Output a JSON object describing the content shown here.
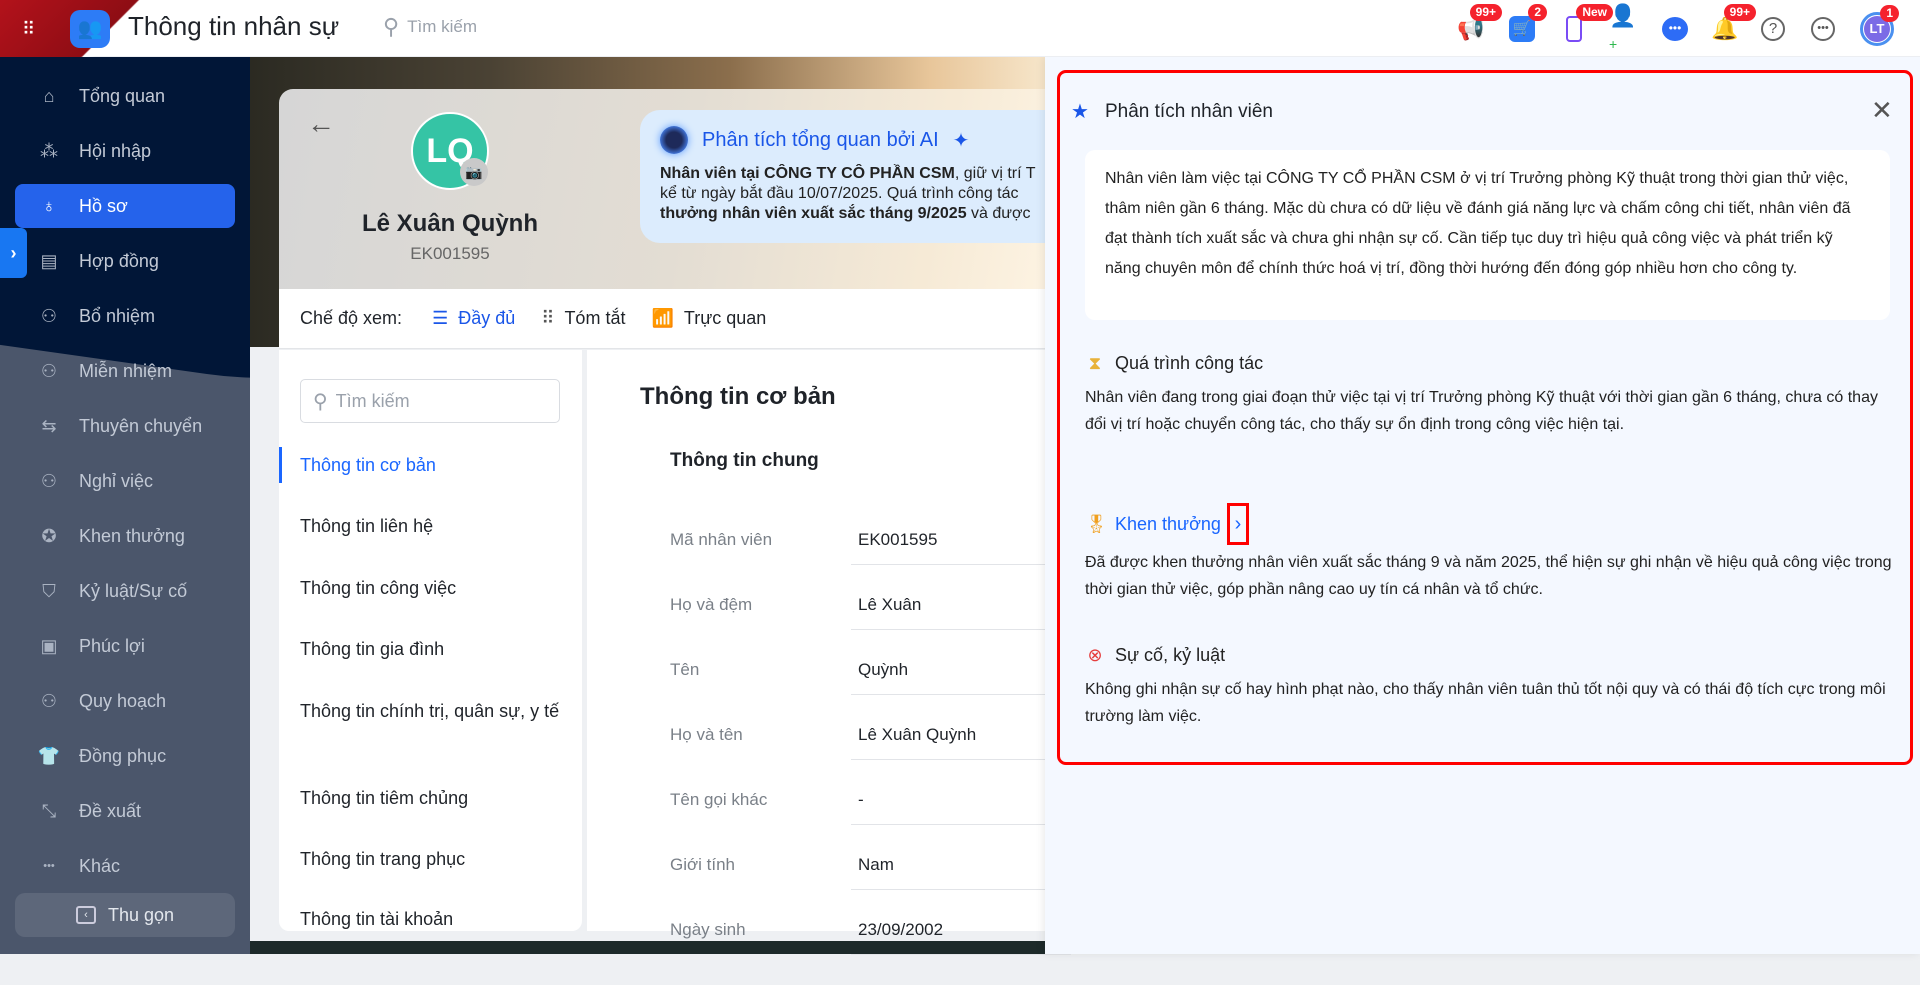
{
  "header": {
    "app_title": "Thông tin nhân sự",
    "search_placeholder": "Tìm kiếm",
    "badges": {
      "announcements": "99+",
      "cart": "2",
      "mobile": "New",
      "notifications": "99+",
      "avatar": "1"
    },
    "avatar_initials": "LT"
  },
  "sidebar": {
    "items": [
      {
        "label": "Tổng quan",
        "icon": "home-icon"
      },
      {
        "label": "Hội nhập",
        "icon": "team-icon"
      },
      {
        "label": "Hồ sơ",
        "icon": "user-icon",
        "active": true
      },
      {
        "label": "Hợp đồng",
        "icon": "document-icon"
      },
      {
        "label": "Bổ nhiệm",
        "icon": "user-plus-icon"
      },
      {
        "label": "Miễn nhiệm",
        "icon": "user-minus-icon"
      },
      {
        "label": "Thuyên chuyển",
        "icon": "transfer-icon"
      },
      {
        "label": "Nghỉ việc",
        "icon": "user-x-icon"
      },
      {
        "label": "Khen thưởng",
        "icon": "ticket-star-icon"
      },
      {
        "label": "Kỷ luật/Sự cố",
        "icon": "shield-x-icon"
      },
      {
        "label": "Phúc lợi",
        "icon": "certificate-icon"
      },
      {
        "label": "Quy hoạch",
        "icon": "users-icon"
      },
      {
        "label": "Đồng phục",
        "icon": "shirt-icon"
      },
      {
        "label": "Đề xuất",
        "icon": "route-icon"
      },
      {
        "label": "Khác",
        "icon": "more-icon"
      }
    ],
    "collapse_label": "Thu gọn"
  },
  "profile": {
    "initials": "LQ",
    "name": "Lê Xuân Quỳnh",
    "code": "EK001595",
    "ai_box": {
      "title": "Phân tích tổng quan bởi AI",
      "line1_bold": "Nhân viên tại CÔNG TY CÔ PHẦN CSM",
      "line1_rest": ", giữ vị trí T",
      "line2": "kể từ ngày bắt đầu 10/07/2025. Quá trình công tác",
      "line3_bold": "thưởng nhân viên xuất sắc tháng 9/2025",
      "line3_rest": " và được"
    }
  },
  "view_mode": {
    "label": "Chế độ xem:",
    "options": [
      {
        "label": "Đầy đủ",
        "active": true
      },
      {
        "label": "Tóm tắt"
      },
      {
        "label": "Trực quan"
      }
    ]
  },
  "left_nav": {
    "search_placeholder": "Tìm kiếm",
    "items": [
      "Thông tin cơ bản",
      "Thông tin liên hệ",
      "Thông tin công việc",
      "Thông tin gia đình",
      "Thông tin chính trị, quân sự, y tế",
      "Thông tin tiêm chủng",
      "Thông tin trang phục",
      "Thông tin tài khoản"
    ]
  },
  "content": {
    "section_title": "Thông tin cơ bản",
    "subsection_title": "Thông tin chung",
    "fields": [
      {
        "label": "Mã nhân viên",
        "value": "EK001595"
      },
      {
        "label": "Họ và đệm",
        "value": "Lê Xuân"
      },
      {
        "label": "Tên",
        "value": "Quỳnh"
      },
      {
        "label": "Họ và tên",
        "value": "Lê Xuân Quỳnh"
      },
      {
        "label": "Tên gọi khác",
        "value": "-"
      },
      {
        "label": "Giới tính",
        "value": "Nam"
      },
      {
        "label": "Ngày sinh",
        "value": "23/09/2002"
      }
    ]
  },
  "panel": {
    "title": "Phân tích nhân viên",
    "summary": "Nhân viên làm việc tại CÔNG TY CỔ PHẦN CSM ở vị trí Trưởng phòng Kỹ thuật trong thời gian thử việc, thâm niên gần 6 tháng. Mặc dù chưa có dữ liệu về đánh giá năng lực và chấm công chi tiết, nhân viên đã đạt thành tích xuất sắc và chưa ghi nhận sự cố. Cần tiếp tục duy trì hiệu quả công việc và phát triển kỹ năng chuyên môn để chính thức hoá vị trí, đồng thời hướng đến đóng góp nhiều hơn cho công ty.",
    "sections": [
      {
        "title": "Quá trình công tác",
        "text": "Nhân viên đang trong giai đoạn thử việc tại vị trí Trưởng phòng Kỹ thuật với thời gian gần 6 tháng, chưa có thay đổi vị trí hoặc chuyển công tác, cho thấy sự ổn định trong công việc hiện tại."
      },
      {
        "title": "Khen thưởng",
        "text": "Đã được khen thưởng nhân viên xuất sắc tháng 9 và năm 2025, thể hiện sự ghi nhận về hiệu quả công việc trong thời gian thử việc, góp phần nâng cao uy tín cá nhân và tổ chức."
      },
      {
        "title": "Sự cố, kỷ luật",
        "text": "Không ghi nhận sự cố hay hình phạt nào, cho thấy nhân viên tuân thủ tốt nội quy và có thái độ tích cực trong môi trường làm việc."
      }
    ]
  },
  "colors": {
    "accent": "#2563eb",
    "sidebar_dark": "#011637",
    "sidebar": "#4b566b",
    "highlight": "#ff0000",
    "avatar": "#35c4a5"
  }
}
